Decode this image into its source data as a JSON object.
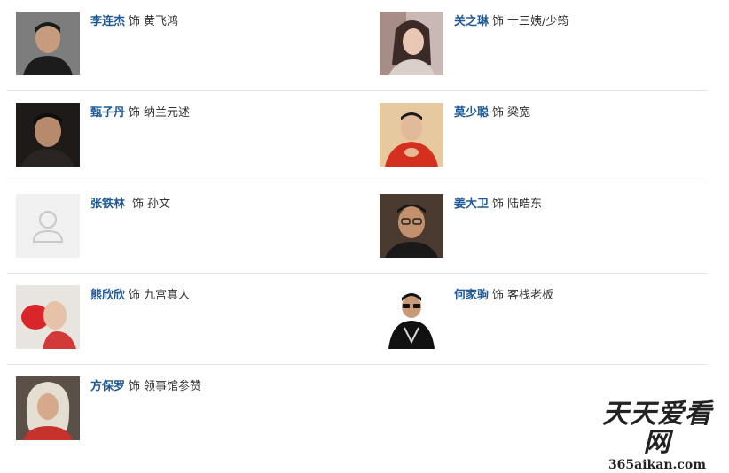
{
  "separator": "饰",
  "cast": [
    {
      "actor": "李连杰",
      "role": "黄飞鸿",
      "photo": "portrait-man-dark-jacket"
    },
    {
      "actor": "关之琳",
      "role": "十三姨/少筠",
      "photo": "portrait-woman"
    },
    {
      "actor": "甄子丹",
      "role": "纳兰元述",
      "photo": "portrait-man-dark"
    },
    {
      "actor": "莫少聪",
      "role": "梁宽",
      "photo": "portrait-man-red-shirt"
    },
    {
      "actor": "张铁林",
      "role": "孙文",
      "photo": "placeholder-avatar"
    },
    {
      "actor": "姜大卫",
      "role": "陆皓东",
      "photo": "portrait-man-glasses"
    },
    {
      "actor": "熊欣欣",
      "role": "九宫真人",
      "photo": "portrait-bald-man-red"
    },
    {
      "actor": "何家驹",
      "role": "客栈老板",
      "photo": "portrait-man-sunglasses"
    },
    {
      "actor": "方保罗",
      "role": "领事馆参赞",
      "photo": "portrait-man-wig"
    }
  ],
  "actor_link_color": "#1f5a96",
  "watermark": {
    "title": "天天爱看网",
    "url": "365aikan.com"
  }
}
